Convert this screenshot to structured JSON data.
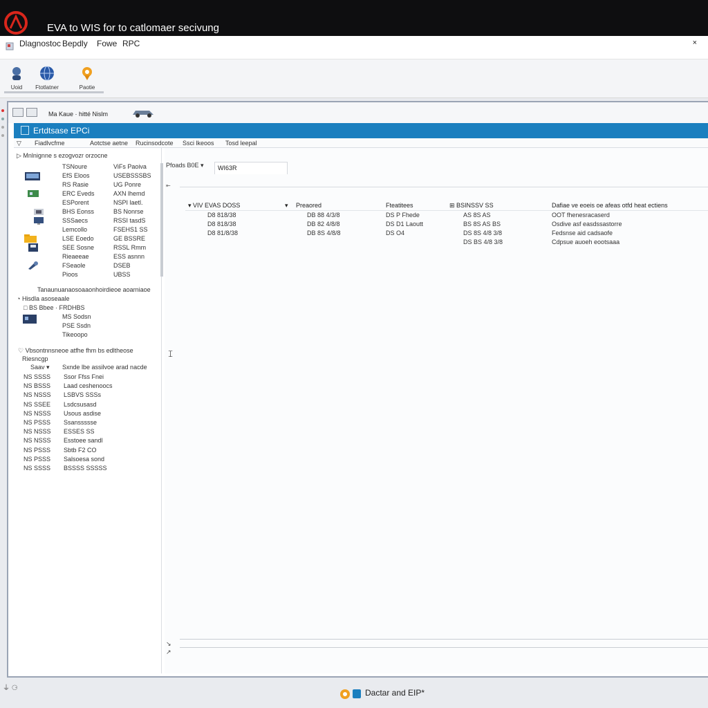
{
  "window": {
    "title": "EVA to WIS for to catlomaer secivung",
    "title_color": "#ffffff",
    "accent_color": "#1b7fbf"
  },
  "menu": {
    "items": [
      "Dlagnostoc",
      "Bepdly",
      "Fowe",
      "RPC"
    ],
    "close_label": "×"
  },
  "toolbar": {
    "buttons": [
      {
        "label": "Uoid",
        "icon": "person-icon"
      },
      {
        "label": "Ftotlatner",
        "icon": "globe-icon"
      },
      {
        "label": "Paotie",
        "icon": "pin-icon"
      }
    ]
  },
  "subwindow": {
    "toptext": "Ma Kaue · hitté Nislm",
    "panel_title": "Ertdtsase EPCi",
    "tabs": [
      "Fiadlvcfme",
      "Aotctse aetne",
      "Rucinsodcote",
      "Ssci lkeoos",
      "Tosd leepal"
    ]
  },
  "tree": {
    "section1_header": "Mnlnignne s ezogvozr orzocne",
    "rows1": [
      {
        "a": "TSNoure",
        "b": "ViFs Paoiva"
      },
      {
        "a": "EfS Eloos",
        "b": "USEBSSSBS"
      },
      {
        "a": "RS Rasie",
        "b": "UG Ponre"
      },
      {
        "a": "ERC Eveds",
        "b": "AXN lhemd"
      },
      {
        "a": "ESPorent",
        "b": "NSPI laetl."
      },
      {
        "a": "BHS Eonss",
        "b": "BS Nonrse"
      },
      {
        "a": "SSSaecs",
        "b": "RSSI tasdS"
      },
      {
        "a": "Lemcollo",
        "b": "FSEHS1 SS"
      },
      {
        "a": "LSE Eoedo",
        "b": "GE BSSRE"
      },
      {
        "a": "SEE Sosne",
        "b": "RSSL Rmm"
      },
      {
        "a": "Rieaeeae",
        "b": "ESS asnnn"
      },
      {
        "a": "FSeaole",
        "b": "DSEB"
      },
      {
        "a": "Pioos",
        "b": "UBSS"
      }
    ],
    "section2_header": "Tanaunuanaosoaaonhoirdieoe aoarniaoe",
    "section2_sub": "Hisdla asoseaale",
    "section2_subsub": "BS Bbee · FRDHBS",
    "rows2": [
      "MS Sodsn",
      "PSE Ssdn",
      "Tikeoopo"
    ],
    "section3_header": "Vbsontnnsneoe atfhe fhm bs edltheose",
    "section3_sub": "Riesncgp",
    "section3_colhead_a": "Saav",
    "section3_colhead_b": "Sxnde lbe assilvoe arad nacde",
    "rows3": [
      {
        "a": "NS SSSS",
        "b": "Ssor Ffss Fnei"
      },
      {
        "a": "NS BSSS",
        "b": "Laad ceshenoocs"
      },
      {
        "a": "NS NSSS",
        "b": "LSBVS SSSs"
      },
      {
        "a": "NS SSEE",
        "b": "Lsdcsusasd"
      },
      {
        "a": "NS NSSS",
        "b": "Usous asdise"
      },
      {
        "a": "NS PSSS",
        "b": "Ssanssssse"
      },
      {
        "a": "NS NSSS",
        "b": "ESSES SS"
      },
      {
        "a": "NS NSSS",
        "b": "Esstoee sandl"
      },
      {
        "a": "NS PSSS",
        "b": "Sbtb F2 CO"
      },
      {
        "a": "NS PSSS",
        "b": "Salsoesa sond"
      },
      {
        "a": "NS SSSS",
        "b": "BSSSS SSSSS"
      }
    ]
  },
  "right": {
    "path_label": "Pfoads  B0E ▾",
    "tab_label": "WI63R",
    "columns": [
      "VIV EVAS DOSS",
      "Preaored",
      "Fteatitees",
      "BSINSSV SS",
      "Dafiae ve eoeis oe afeas otfd heat ectiens"
    ],
    "rows": [
      [
        "D8 818/38",
        "DB 88 4/3/8",
        "DS P Fhede",
        "AS 8S AS",
        "OOT fhenesracaserd"
      ],
      [
        "D8 818/38",
        "DB 82 4/8/8",
        "DS D1 Laoutt",
        "BS 8S AS BS",
        "Osdive asf easdssastorre"
      ],
      [
        "D8 81/8/38",
        "DB 8S 4/8/8",
        "DS O4",
        "DS 8S 4/8 3/8",
        "Fedsnse aid cadsaofe"
      ],
      [
        "",
        "",
        "",
        "DS BS 4/8 3/8",
        "Cdpsue auoeh eootsaaa"
      ]
    ]
  },
  "status": {
    "left_icons": "⏚ ⚆",
    "text": "Dactar and EIP*"
  }
}
